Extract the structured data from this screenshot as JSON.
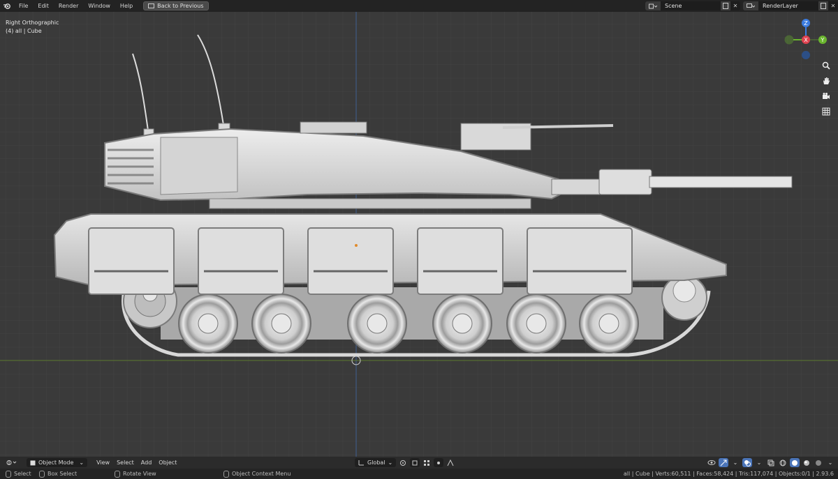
{
  "menu": {
    "items": [
      "File",
      "Edit",
      "Render",
      "Window",
      "Help"
    ],
    "back_button": "Back to Previous"
  },
  "scene": {
    "value": "Scene"
  },
  "render_layer": {
    "value": "RenderLayer"
  },
  "viewport": {
    "view_name": "Right Orthographic",
    "collection_info": "(4) all | Cube"
  },
  "gizmo": {
    "labels": {
      "z": "Z",
      "y": "Y",
      "x": "X"
    }
  },
  "header": {
    "mode": "Object Mode",
    "menus": [
      "View",
      "Select",
      "Add",
      "Object"
    ],
    "orientation": "Global"
  },
  "status": {
    "select": "Select",
    "box_select": "Box Select",
    "rotate": "Rotate View",
    "context_menu": "Object Context Menu",
    "stats": "all | Cube | Verts:60,511 | Faces:58,424 | Tris:117,074 | Objects:0/1 | 2.93.6"
  },
  "colors": {
    "x_axis": "#e0424f",
    "y_axis": "#6ab52e",
    "z_axis": "#3b7ce0",
    "accent": "#4a74b8"
  },
  "icons": {
    "logo": "blender-logo-icon",
    "zoom": "zoom-icon",
    "pan": "hand-icon",
    "camera": "camera-icon",
    "ortho": "grid-icon"
  }
}
